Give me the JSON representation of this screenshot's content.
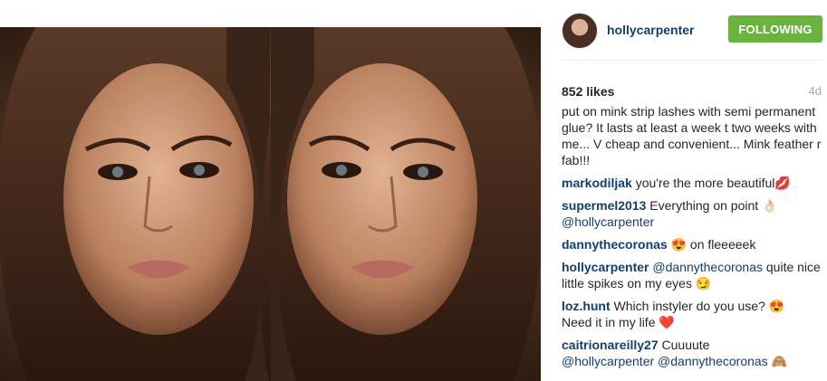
{
  "post": {
    "username": "hollycarpenter",
    "follow_label": "FOLLOWING",
    "likes": "852 likes",
    "age": "4d"
  },
  "caption_partial": "put on mink strip lashes with semi permanent glue? It lasts at least a week t two weeks with me... V cheap and convenient... Mink feather r fab!!!",
  "comments": [
    {
      "user": "markodiljak",
      "text": "you're the more beautiful",
      "emoji": "💋"
    },
    {
      "user": "supermel2013",
      "text": "Everything on point",
      "emoji": "👌🏻",
      "mention": "@hollycarpenter"
    },
    {
      "user": "dannythecoronas",
      "emoji": "😍",
      "text": "on fleeeeek"
    },
    {
      "user": "hollycarpenter",
      "mention": "@dannythecoronas",
      "text": "quite nice little spikes on my eyes",
      "emoji": "😏"
    },
    {
      "user": "loz.hunt",
      "text": "Which instyler do you use?",
      "emoji": "😍",
      "text2": "Need it in my life",
      "emoji2": "❤️"
    },
    {
      "user": "caitrionareilly27",
      "text": "Cuuuute",
      "mention": "@hollycarpenter",
      "mention2": "@dannythecoronas",
      "emoji": "🙈"
    }
  ],
  "icons": {
    "avatar": "profile-avatar",
    "photo": "mirrored-selfie-photo"
  }
}
